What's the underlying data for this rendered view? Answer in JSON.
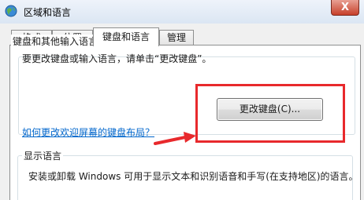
{
  "window": {
    "title": "区域和语言",
    "close_label": "X",
    "icon": "globe-icon",
    "close_color": "#c7402a"
  },
  "tabs": [
    {
      "label": "格式",
      "active": false
    },
    {
      "label": "位置",
      "active": false
    },
    {
      "label": "键盘和语言",
      "active": true
    },
    {
      "label": "管理",
      "active": false
    }
  ],
  "keyboard_group": {
    "title": "键盘和其他输入语言",
    "description": "要更改键盘或输入语言，请单击“更改键盘”。",
    "button_label": "更改键盘(C)..."
  },
  "link_text": "如何更改欢迎屏幕的键盘布局？",
  "display_group": {
    "title": "显示语言",
    "description": "安装或卸载 Windows 可用于显示文本和识别语音和手写(在支持地区)的语言。"
  },
  "annotation": {
    "highlight_color": "#e8292c",
    "arrow_color": "#e8292c"
  }
}
